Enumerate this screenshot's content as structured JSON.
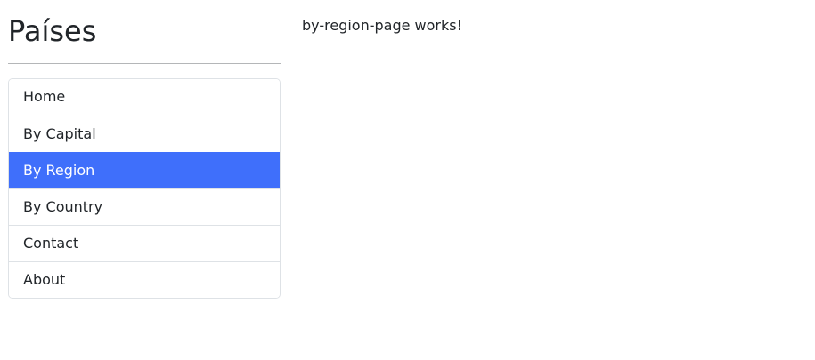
{
  "sidebar": {
    "title": "Países",
    "items": [
      {
        "label": "Home",
        "active": false
      },
      {
        "label": "By Capital",
        "active": false
      },
      {
        "label": "By Region",
        "active": true
      },
      {
        "label": "By Country",
        "active": false
      },
      {
        "label": "Contact",
        "active": false
      },
      {
        "label": "About",
        "active": false
      }
    ]
  },
  "main": {
    "message": "by-region-page works!"
  },
  "colors": {
    "active_background": "#3f6ffb",
    "active_text": "#ffffff",
    "border": "#dee2e6"
  }
}
